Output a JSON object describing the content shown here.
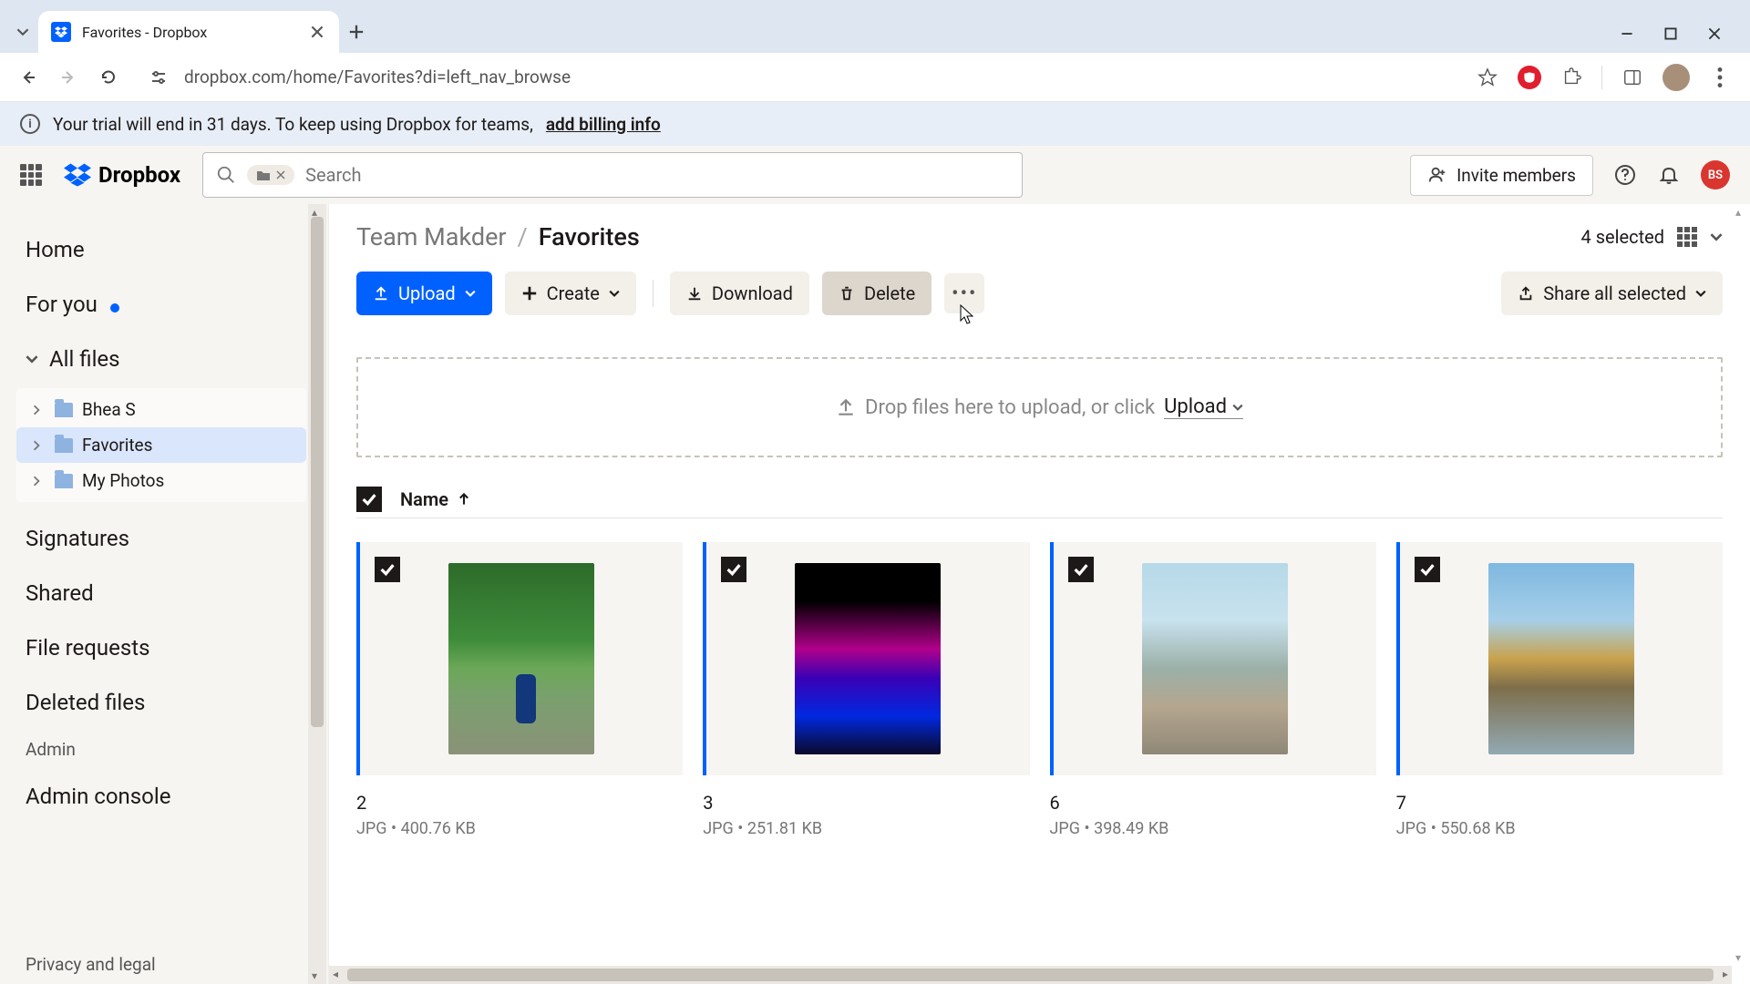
{
  "browser": {
    "tab_title": "Favorites - Dropbox",
    "url": "dropbox.com/home/Favorites?di=left_nav_browse"
  },
  "trial_banner": {
    "text": "Your trial will end in 31 days. To keep using Dropbox for teams,",
    "link": "add billing info"
  },
  "header": {
    "logo": "Dropbox",
    "search_placeholder": "Search",
    "invite_label": "Invite members",
    "user_initials": "BS"
  },
  "sidebar": {
    "home": "Home",
    "for_you": "For you",
    "all_files": "All files",
    "folders": [
      {
        "name": "Bhea S"
      },
      {
        "name": "Favorites"
      },
      {
        "name": "My Photos"
      }
    ],
    "signatures": "Signatures",
    "shared": "Shared",
    "file_requests": "File requests",
    "deleted": "Deleted files",
    "admin": "Admin",
    "admin_console": "Admin console",
    "privacy": "Privacy and legal"
  },
  "breadcrumb": {
    "team": "Team Makder",
    "current": "Favorites"
  },
  "selection_count": "4 selected",
  "actions": {
    "upload": "Upload",
    "create": "Create",
    "download": "Download",
    "delete": "Delete",
    "share": "Share all selected"
  },
  "dropzone": {
    "text": "Drop files here to upload, or click",
    "link": "Upload"
  },
  "list_header": {
    "name": "Name"
  },
  "files": [
    {
      "name": "2",
      "type": "JPG",
      "size": "400.76 KB"
    },
    {
      "name": "3",
      "type": "JPG",
      "size": "251.81 KB"
    },
    {
      "name": "6",
      "type": "JPG",
      "size": "398.49 KB"
    },
    {
      "name": "7",
      "type": "JPG",
      "size": "550.68 KB"
    }
  ]
}
